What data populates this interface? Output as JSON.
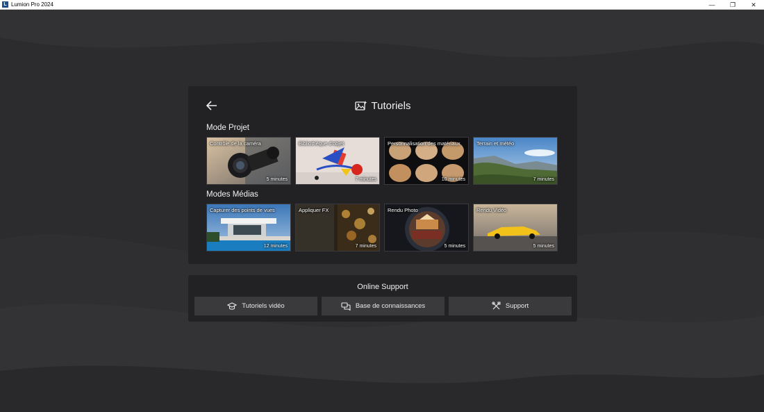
{
  "window": {
    "title": "Lumion Pro 2024",
    "logo_letter": "L",
    "controls": {
      "minimize": "—",
      "restore": "❐",
      "close": "✕"
    }
  },
  "tutorials": {
    "title": "Tutoriels",
    "sections": [
      {
        "title": "Mode Projet",
        "cards": [
          {
            "label": "Contrôle de la caméra",
            "duration": "5 minutes"
          },
          {
            "label": "Bibliothèque d'objet",
            "duration": "7 minutes"
          },
          {
            "label": "Personnalisation des matériaux",
            "duration": "10 minutes"
          },
          {
            "label": "Terrain et météo",
            "duration": "7 minutes"
          }
        ]
      },
      {
        "title": "Modes Médias",
        "cards": [
          {
            "label": "Capturer des points de vues",
            "duration": "12 minutes"
          },
          {
            "label": "Appliquer FX",
            "duration": "7 minutes"
          },
          {
            "label": "Rendu Photo",
            "duration": "5 minutes"
          },
          {
            "label": "Rendu Vidéo",
            "duration": "5 minutes"
          }
        ]
      }
    ]
  },
  "support": {
    "title": "Online Support",
    "buttons": [
      {
        "label": "Tutoriels vidéo",
        "icon": "graduation-cap-icon"
      },
      {
        "label": "Base de connaissances",
        "icon": "chat-bubbles-icon"
      },
      {
        "label": "Support",
        "icon": "tools-icon"
      }
    ]
  }
}
